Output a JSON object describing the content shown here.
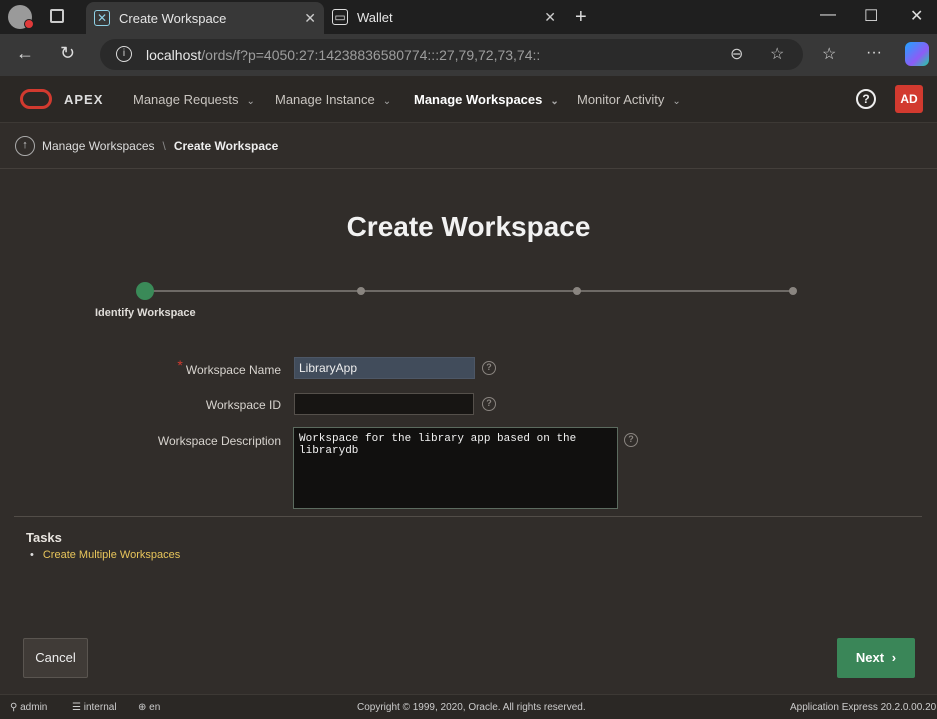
{
  "browser": {
    "tabs": [
      {
        "title": "Create Workspace",
        "active": true
      },
      {
        "title": "Wallet",
        "active": false
      }
    ],
    "url": {
      "host": "localhost",
      "path": "/ords/f?p=4050:27:14238836580774:::27,79,72,73,74::"
    }
  },
  "apex": {
    "logo": "APEX",
    "nav": [
      {
        "label": "Manage Requests",
        "current": false
      },
      {
        "label": "Manage Instance",
        "current": false
      },
      {
        "label": "Manage Workspaces",
        "current": true
      },
      {
        "label": "Monitor Activity",
        "current": false
      }
    ],
    "avatar": "AD"
  },
  "breadcrumb": {
    "parent": "Manage Workspaces",
    "current": "Create Workspace"
  },
  "page": {
    "title": "Create Workspace",
    "wizard": {
      "total_steps": 4,
      "current_step": 1,
      "current_label": "Identify Workspace"
    },
    "form": {
      "name_label": "Workspace Name",
      "name_value": "LibraryApp",
      "id_label": "Workspace ID",
      "id_value": "",
      "desc_label": "Workspace Description",
      "desc_value": "Workspace for the library app based on the librarydb"
    },
    "tasks": {
      "title": "Tasks",
      "link": "Create Multiple Workspaces"
    },
    "buttons": {
      "cancel": "Cancel",
      "next": "Next"
    }
  },
  "footer": {
    "user": "admin",
    "workspace": "internal",
    "language": "en",
    "copyright": "Copyright © 1999, 2020, Oracle. All rights reserved.",
    "version": "Application Express 20.2.0.00.20"
  },
  "colors": {
    "accent_green": "#3a8658",
    "brand_red": "#d23a2f",
    "link_yellow": "#e8c55b"
  }
}
